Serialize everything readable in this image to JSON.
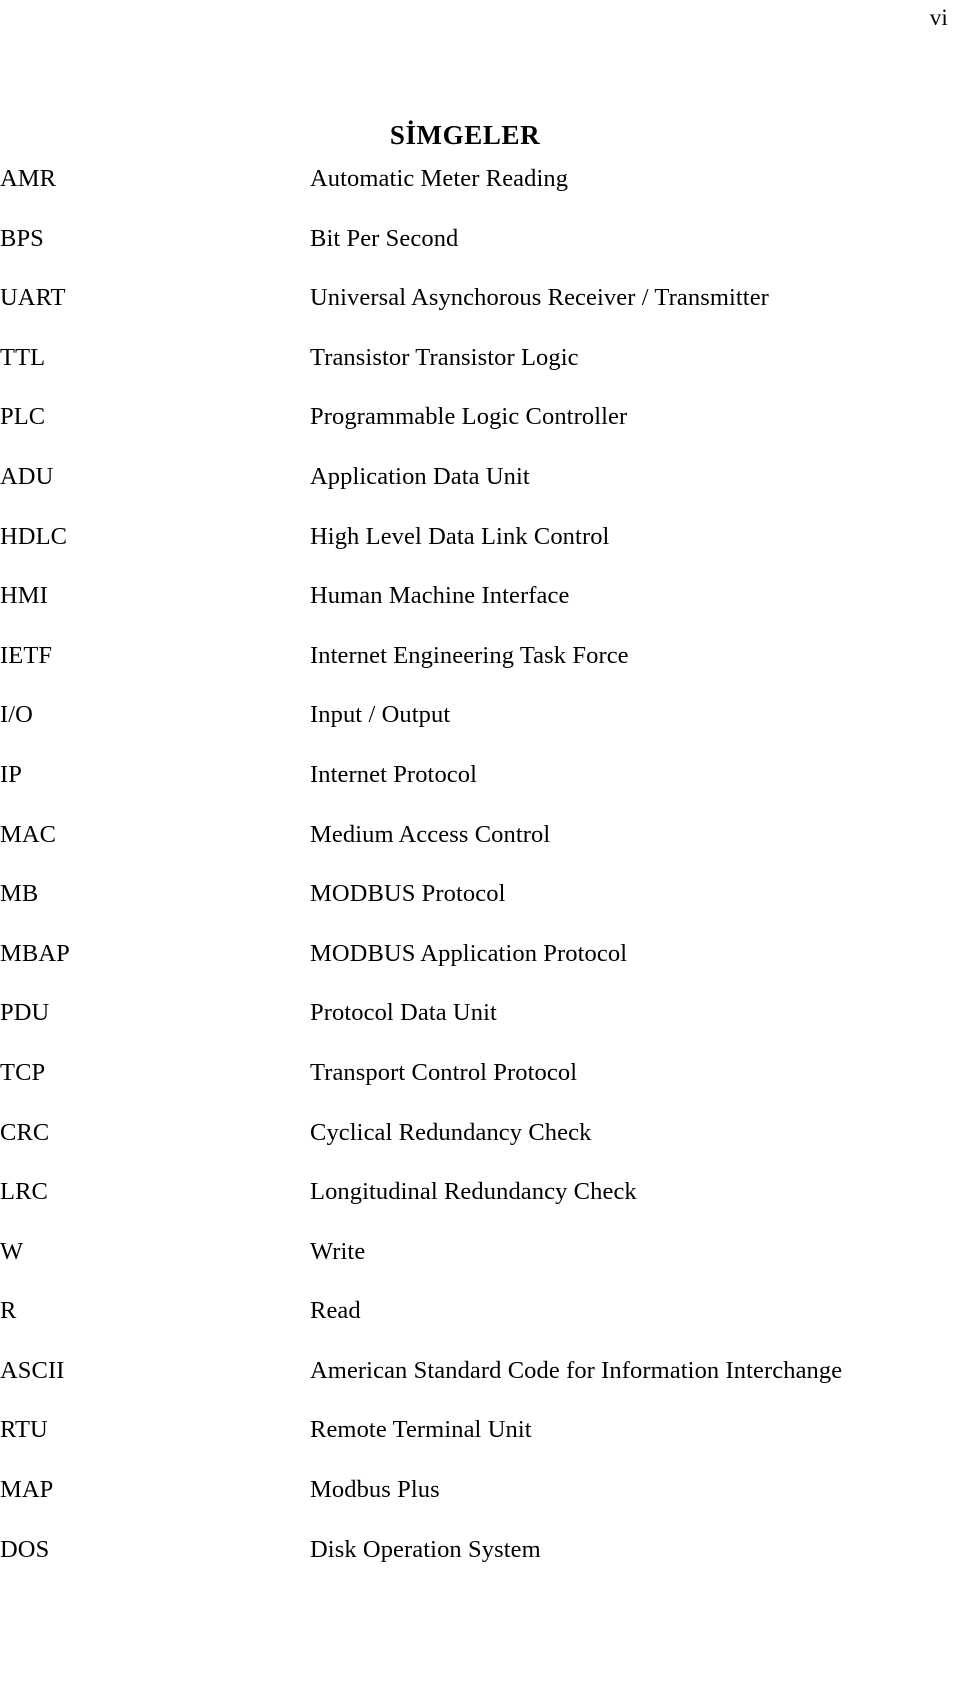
{
  "page": {
    "page_number": "vi",
    "title": "SİMGELER"
  },
  "abbreviations": [
    {
      "term": "AMR",
      "definition": "Automatic Meter Reading"
    },
    {
      "term": "BPS",
      "definition": "Bit Per Second"
    },
    {
      "term": "UART",
      "definition": "Universal Asynchorous Receiver / Transmitter"
    },
    {
      "term": "TTL",
      "definition": "Transistor Transistor Logic"
    },
    {
      "term": "PLC",
      "definition": "Programmable Logic Controller"
    },
    {
      "term": "ADU",
      "definition": "Application Data Unit"
    },
    {
      "term": "HDLC",
      "definition": "High Level Data Link Control"
    },
    {
      "term": "HMI",
      "definition": "Human Machine Interface"
    },
    {
      "term": "IETF",
      "definition": "Internet Engineering Task Force"
    },
    {
      "term": "I/O",
      "definition": "Input / Output"
    },
    {
      "term": "IP",
      "definition": "Internet Protocol"
    },
    {
      "term": "MAC",
      "definition": "Medium Access Control"
    },
    {
      "term": "MB",
      "definition": "MODBUS Protocol"
    },
    {
      "term": "MBAP",
      "definition": "MODBUS Application Protocol"
    },
    {
      "term": "PDU",
      "definition": "Protocol Data Unit"
    },
    {
      "term": "TCP",
      "definition": "Transport Control Protocol"
    },
    {
      "term": "CRC",
      "definition": "Cyclical Redundancy Check"
    },
    {
      "term": "LRC",
      "definition": "Longitudinal Redundancy Check"
    },
    {
      "term": "W",
      "definition": "Write"
    },
    {
      "term": "R",
      "definition": "Read"
    },
    {
      "term": "ASCII",
      "definition": "American Standard Code for Information Interchange"
    },
    {
      "term": "RTU",
      "definition": "Remote Terminal Unit"
    },
    {
      "term": "MAP",
      "definition": "Modbus Plus"
    },
    {
      "term": "DOS",
      "definition": "Disk Operation System"
    }
  ]
}
